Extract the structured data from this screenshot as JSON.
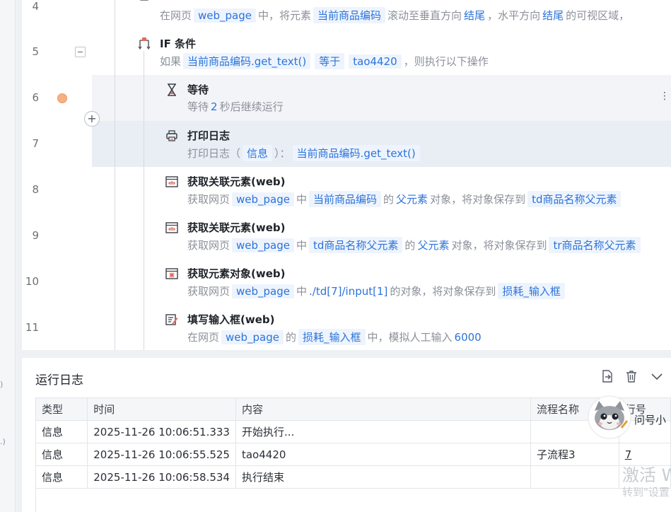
{
  "gutter": {
    "fragments": [
      ")",
      ".)"
    ]
  },
  "editor": {
    "line_numbers": [
      "4",
      "5",
      "6",
      "7",
      "8",
      "9",
      "10",
      "11"
    ],
    "steps": {
      "s4": {
        "desc_parts": [
          "在网页",
          "web_page",
          "中，将元素",
          "当前商品编码",
          "滚动至垂直方向",
          "结尾",
          "，水平方向",
          "结尾",
          "的可视区域，"
        ]
      },
      "s5": {
        "title": "IF 条件",
        "desc_parts": [
          "如果",
          "当前商品编码.get_text()",
          "等于",
          "tao4420",
          "，则执行以下操作"
        ]
      },
      "s6": {
        "title": "等待",
        "desc_parts": [
          "等待",
          "2",
          "秒后继续运行"
        ]
      },
      "s7": {
        "title": "打印日志",
        "desc_parts": [
          "打印日志（",
          "信息",
          "）：",
          "当前商品编码.get_text()"
        ]
      },
      "s8": {
        "title": "获取关联元素(web)",
        "desc_parts": [
          "获取网页",
          "web_page",
          "中",
          "当前商品编码",
          "的",
          "父元素",
          "对象，将对象保存到",
          "td商品名称父元素"
        ]
      },
      "s9": {
        "title": "获取关联元素(web)",
        "desc_parts": [
          "获取网页",
          "web_page",
          "中",
          "td商品名称父元素",
          "的",
          "父元素",
          "对象，将对象保存到",
          "tr商品名称父元素"
        ]
      },
      "s10": {
        "title": "获取元素对象(web)",
        "desc_parts": [
          "获取网页",
          "web_page",
          "中",
          "./td[7]/input[1]",
          "的对象，将对象保存到",
          "损耗_输入框"
        ]
      },
      "s11": {
        "title": "填写输入框(web)",
        "desc_parts": [
          "在网页",
          "web_page",
          "的",
          "损耗_输入框",
          "中，模拟人工输入",
          "6000"
        ]
      }
    },
    "plus_label": "+",
    "more_label": "⋮"
  },
  "log": {
    "title": "运行日志",
    "columns": [
      "类型",
      "时间",
      "内容",
      "流程名称",
      "行号"
    ],
    "rows": [
      [
        "信息",
        "2025-11-26 10:06:51.333",
        "开始执行...",
        "",
        ""
      ],
      [
        "信息",
        "2025-11-26 10:06:55.525",
        "tao4420",
        "子流程3",
        "7"
      ],
      [
        "信息",
        "2025-11-26 10:06:58.534",
        "执行结束",
        "",
        ""
      ]
    ]
  },
  "overlay": {
    "mascot_text": "问号小",
    "watermark_line1": "激活 W",
    "watermark_line2": "转到\"设置"
  },
  "colors": {
    "accent": "#2b73d9",
    "chip_bg": "#eef4fd",
    "breakpoint": "#f4b183"
  }
}
